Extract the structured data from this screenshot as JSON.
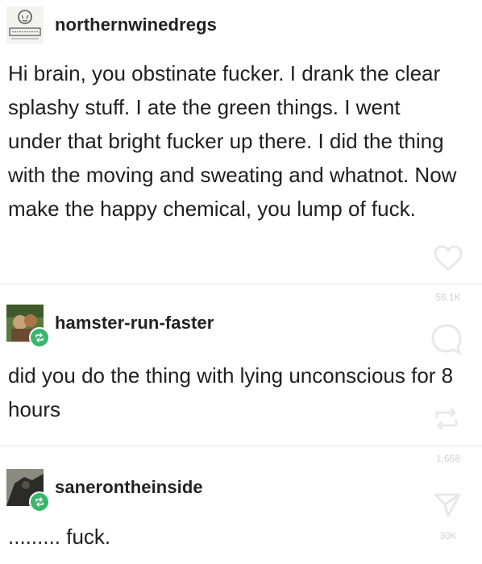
{
  "posts": [
    {
      "username": "northernwinedregs",
      "body": "Hi brain, you obstinate fucker. I drank the clear splashy stuff. I ate the green things. I went under that bright fucker up there. I did the thing with the moving and sweating and whatnot. Now make the happy chemical, you lump of fuck.",
      "avatar": "stamp-avatar"
    },
    {
      "username": "hamster-run-faster",
      "body": "did you do the thing with lying unconscious for 8 hours",
      "avatar": "photo-avatar",
      "reblogged": true
    },
    {
      "username": "sanerontheinside",
      "body": "......... fuck.",
      "avatar": "dark-avatar",
      "reblogged": true
    }
  ],
  "side_actions": {
    "like_icon": "heart-icon",
    "like_count": "56.1K",
    "comment_icon": "comment-icon",
    "reblog_icon": "reblog-icon",
    "reblog_count": "1,668",
    "share_icon": "share-icon",
    "share_count": "30K"
  },
  "colors": {
    "reblog_badge": "#39b86d",
    "divider": "#e3e3e3",
    "faded_icon": "#c9c9c9"
  }
}
